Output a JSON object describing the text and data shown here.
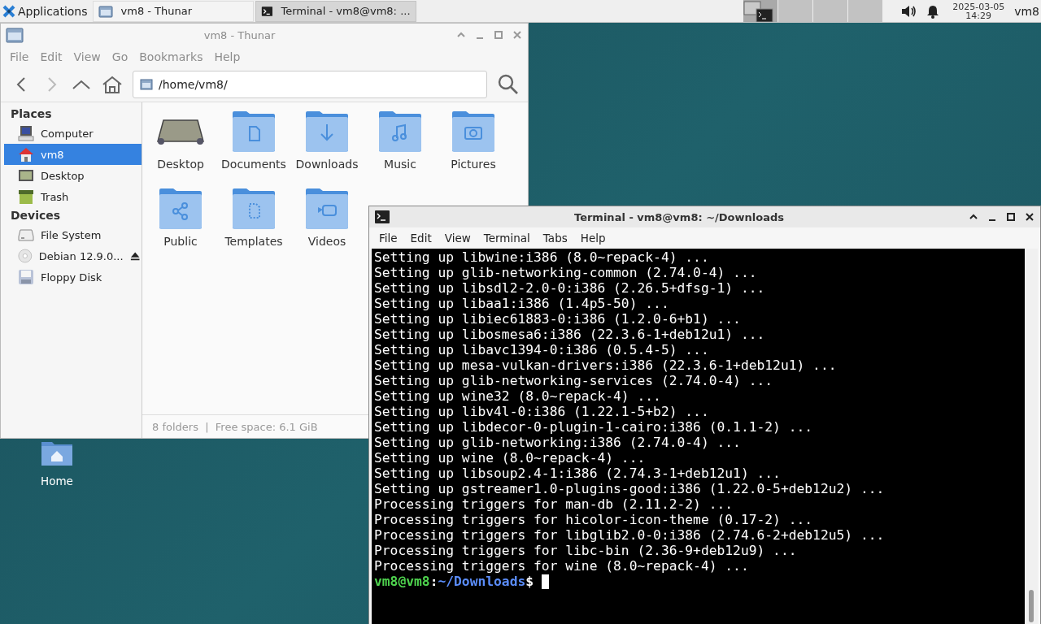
{
  "taskbar": {
    "menu_label": "Applications",
    "tasks": [
      {
        "title": "vm8 - Thunar",
        "kind": "folder",
        "selected": false
      },
      {
        "title": "Terminal - vm8@vm8: ...",
        "kind": "terminal",
        "selected": true
      }
    ],
    "workspaces": [
      {
        "selected": true
      },
      {
        "selected": false
      },
      {
        "selected": false
      },
      {
        "selected": false
      }
    ],
    "date": "2025-03-05",
    "time": "14:29",
    "user": "vm8"
  },
  "desktop_icons": [
    {
      "label": "Home"
    }
  ],
  "file_manager": {
    "title": "vm8 - Thunar",
    "menu": [
      "File",
      "Edit",
      "View",
      "Go",
      "Bookmarks",
      "Help"
    ],
    "location": "/home/vm8/",
    "sidebar": [
      {
        "title": "Places",
        "items": [
          {
            "label": "Computer",
            "kind": "computer",
            "selected": false,
            "eject": false
          },
          {
            "label": "vm8",
            "kind": "home",
            "selected": true,
            "eject": false
          },
          {
            "label": "Desktop",
            "kind": "desktop",
            "selected": false,
            "eject": false
          },
          {
            "label": "Trash",
            "kind": "trash",
            "selected": false,
            "eject": false
          }
        ]
      },
      {
        "title": "Devices",
        "items": [
          {
            "label": "File System",
            "kind": "drive",
            "selected": false,
            "eject": false
          },
          {
            "label": "Debian 12.9.0...",
            "kind": "disc",
            "selected": false,
            "eject": true
          },
          {
            "label": "Floppy Disk",
            "kind": "floppy",
            "selected": false,
            "eject": false
          }
        ]
      }
    ],
    "files": [
      {
        "label": "Desktop",
        "kind": "desktop"
      },
      {
        "label": "Documents",
        "kind": "documents"
      },
      {
        "label": "Downloads",
        "kind": "downloads"
      },
      {
        "label": "Music",
        "kind": "music"
      },
      {
        "label": "Pictures",
        "kind": "pictures"
      },
      {
        "label": "Public",
        "kind": "public"
      },
      {
        "label": "Templates",
        "kind": "templates"
      },
      {
        "label": "Videos",
        "kind": "videos"
      }
    ],
    "status": "8 folders  |  Free space: 6.1 GiB"
  },
  "terminal": {
    "title": "Terminal - vm8@vm8: ~/Downloads",
    "menu": [
      "File",
      "Edit",
      "View",
      "Terminal",
      "Tabs",
      "Help"
    ],
    "lines": [
      "Setting up libwine:i386 (8.0~repack-4) ...",
      "Setting up glib-networking-common (2.74.0-4) ...",
      "Setting up libsdl2-2.0-0:i386 (2.26.5+dfsg-1) ...",
      "Setting up libaa1:i386 (1.4p5-50) ...",
      "Setting up libiec61883-0:i386 (1.2.0-6+b1) ...",
      "Setting up libosmesa6:i386 (22.3.6-1+deb12u1) ...",
      "Setting up libavc1394-0:i386 (0.5.4-5) ...",
      "Setting up mesa-vulkan-drivers:i386 (22.3.6-1+deb12u1) ...",
      "Setting up glib-networking-services (2.74.0-4) ...",
      "Setting up wine32 (8.0~repack-4) ...",
      "Setting up libv4l-0:i386 (1.22.1-5+b2) ...",
      "Setting up libdecor-0-plugin-1-cairo:i386 (0.1.1-2) ...",
      "Setting up glib-networking:i386 (2.74.0-4) ...",
      "Setting up wine (8.0~repack-4) ...",
      "Setting up libsoup2.4-1:i386 (2.74.3-1+deb12u1) ...",
      "Setting up gstreamer1.0-plugins-good:i386 (1.22.0-5+deb12u2) ...",
      "Processing triggers for man-db (2.11.2-2) ...",
      "Processing triggers for hicolor-icon-theme (0.17-2) ...",
      "Processing triggers for libglib2.0-0:i386 (2.74.6-2+deb12u5) ...",
      "Processing triggers for libc-bin (2.36-9+deb12u9) ...",
      "Processing triggers for wine (8.0~repack-4) ..."
    ],
    "prompt": {
      "user": "vm8@vm8",
      "separator": ":",
      "path": "~/Downloads",
      "symbol": "$"
    }
  }
}
